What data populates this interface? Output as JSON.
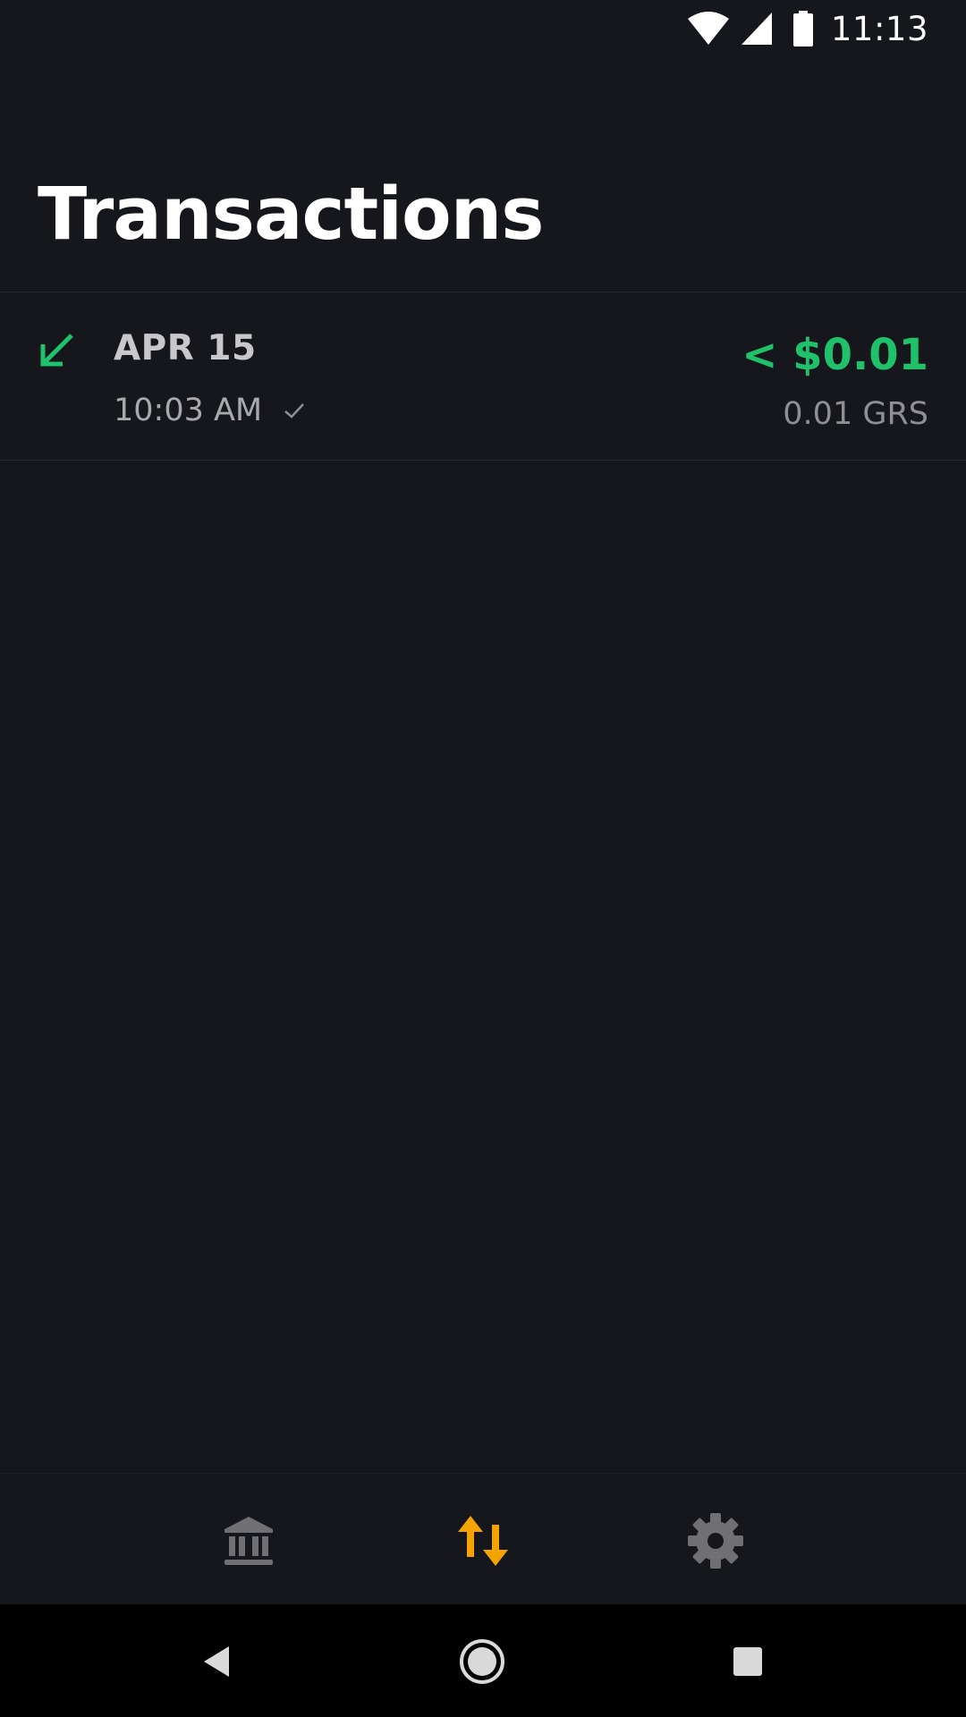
{
  "status_bar": {
    "time": "11:13",
    "icons": [
      "wifi-icon",
      "signal-icon",
      "battery-icon"
    ]
  },
  "header": {
    "title": "Transactions"
  },
  "transactions": [
    {
      "direction_icon": "arrow-down-left-icon",
      "date": "APR 15",
      "time": "10:03 AM",
      "status_icon": "check-icon",
      "fiat_amount": "< $0.01",
      "crypto_amount": "0.01 GRS"
    }
  ],
  "bottom_nav": {
    "items": [
      {
        "icon": "bank-icon",
        "active": false
      },
      {
        "icon": "transfer-arrows-icon",
        "active": true
      },
      {
        "icon": "gear-icon",
        "active": false
      }
    ]
  },
  "system_nav": {
    "items": [
      "back-icon",
      "home-icon",
      "recents-icon"
    ]
  },
  "colors": {
    "background": "#16171c",
    "received": "#1fc26a",
    "accent_active": "#f5a300",
    "inactive_icon": "#6f6f74",
    "secondary_text": "#8e8e93"
  }
}
